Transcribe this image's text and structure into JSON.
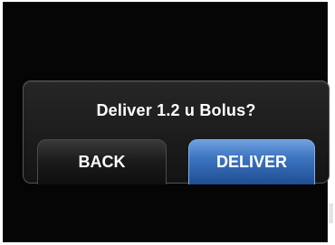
{
  "dialog": {
    "prompt": "Deliver 1.2 u Bolus?",
    "back_label": "BACK",
    "deliver_label": "DELIVER"
  },
  "colors": {
    "screen_background": "#050505",
    "deliver_accent": "#3d74c0"
  }
}
